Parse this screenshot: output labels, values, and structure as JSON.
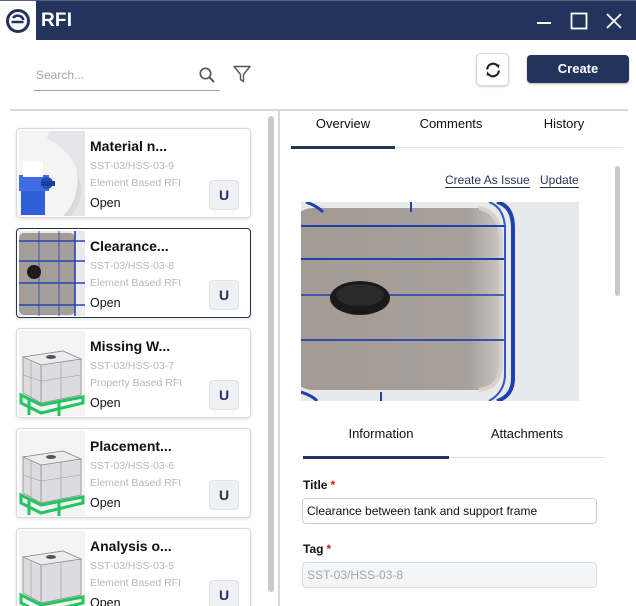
{
  "window": {
    "title": "RFI"
  },
  "toolbar": {
    "search_placeholder": "Search...",
    "create_label": "Create"
  },
  "list": {
    "items": [
      {
        "title": "Material n...",
        "tag": "SST-03/HSS-03-9",
        "type": "Element Based RFI",
        "status": "Open",
        "badge": "U",
        "thumb": "tank-valve"
      },
      {
        "title": "Clearance...",
        "tag": "SST-03/HSS-03-8",
        "type": "Element Based RFI",
        "status": "Open",
        "badge": "U",
        "thumb": "tank-closeup"
      },
      {
        "title": "Missing W...",
        "tag": "SST-03/HSS-03-7",
        "type": "Property Based RFI",
        "status": "Open",
        "badge": "U",
        "thumb": "ibc-tank"
      },
      {
        "title": "Placement...",
        "tag": "SST-03/HSS-03-6",
        "type": "Element Based RFI",
        "status": "Open",
        "badge": "U",
        "thumb": "ibc-tank"
      },
      {
        "title": "Analysis o...",
        "tag": "SST-03/HSS-03-5",
        "type": "Element Based RFI",
        "status": "Open",
        "badge": "U",
        "thumb": "ibc-tank"
      }
    ]
  },
  "detail": {
    "tabs": [
      "Overview",
      "Comments",
      "History"
    ],
    "active_tab": "Overview",
    "actions": {
      "create_issue": "Create As Issue",
      "update": "Update"
    },
    "subtabs": [
      "Information",
      "Attachments"
    ],
    "active_subtab": "Information",
    "fields": {
      "title_label": "Title",
      "title_value": "Clearance between tank and support frame",
      "tag_label": "Tag",
      "tag_value": "SST-03/HSS-03-8",
      "required_mark": "*"
    }
  },
  "colors": {
    "primary": "#23345c",
    "required": "#d0191f"
  }
}
